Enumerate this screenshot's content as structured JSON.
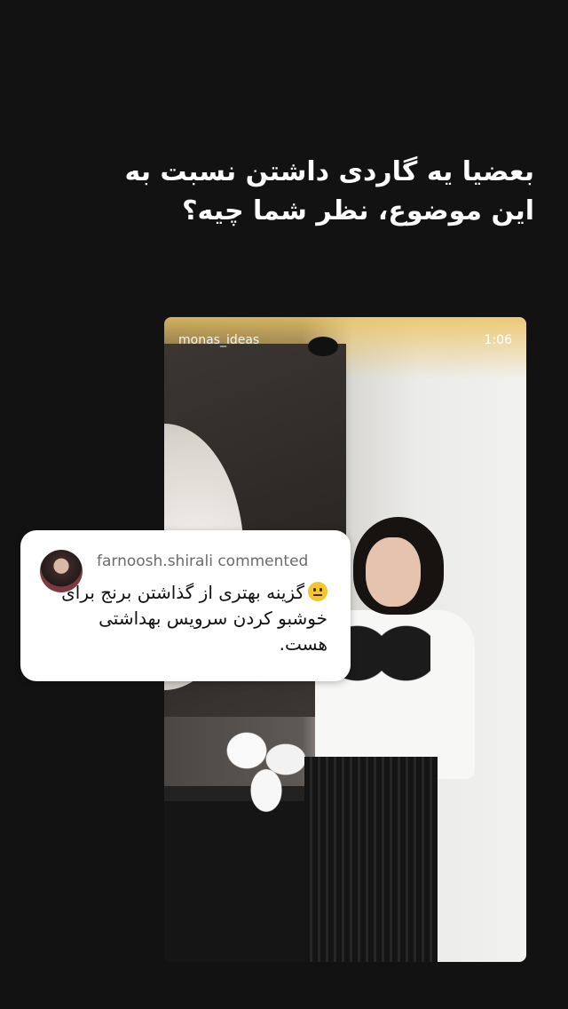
{
  "story": {
    "caption": "بعضیا یه گاردی داشتن نسبت به این موضوع، نظر شما چیه؟"
  },
  "video": {
    "username": "monas_ideas",
    "duration": "1:06"
  },
  "comment": {
    "user": "farnoosh.shirali commented",
    "text": "گزینه بهتری از گذاشتن برنج برای خوشبو کردن سرویس بهداشتی هست.",
    "emoji": "neutral-face-icon"
  }
}
